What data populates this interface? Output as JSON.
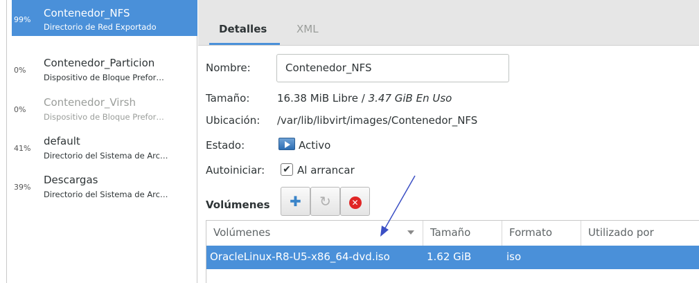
{
  "pools": [
    {
      "percent": "99%",
      "name": "Contenedor_NFS",
      "description": "Directorio de Red Exportado",
      "selected": true
    },
    {
      "percent": "0%",
      "name": "Contenedor_Particion",
      "description": "Dispositivo de Bloque Prefor…"
    },
    {
      "percent": "0%",
      "name": "Contenedor_Virsh",
      "description": "Dispositivo de Bloque Prefor…"
    },
    {
      "percent": "41%",
      "name": "default",
      "description": "Directorio del Sistema de Arc…"
    },
    {
      "percent": "39%",
      "name": "Descargas",
      "description": "Directorio del Sistema de Arc…"
    }
  ],
  "tabs": {
    "details": "Detalles",
    "xml": "XML"
  },
  "details": {
    "name_label": "Nombre:",
    "name_value": "Contenedor_NFS",
    "size_label": "Tamaño:",
    "size_free": "16.38 MiB Libre / ",
    "size_used": "3.47 GiB En Uso",
    "location_label": "Ubicación:",
    "location_value": "/var/lib/libvirt/images/Contenedor_NFS",
    "state_label": "Estado:",
    "state_value": "Activo",
    "autostart_label": "Autoiniciar:",
    "autostart_value": "Al arrancar",
    "autostart_checked": true
  },
  "volumes": {
    "heading": "Volúmenes",
    "icons": {
      "add": "add-icon",
      "refresh": "refresh-icon",
      "delete": "delete-icon"
    },
    "columns": [
      "Volúmenes",
      "Tamaño",
      "Formato",
      "Utilizado por"
    ],
    "rows": [
      {
        "name": "OracleLinux-R8-U5-x86_64-dvd.iso",
        "size": "1.62 GiB",
        "format": "iso",
        "used_by": ""
      }
    ]
  },
  "colors": {
    "selection": "#4a90d9",
    "annotation": "#3b4fc4"
  }
}
